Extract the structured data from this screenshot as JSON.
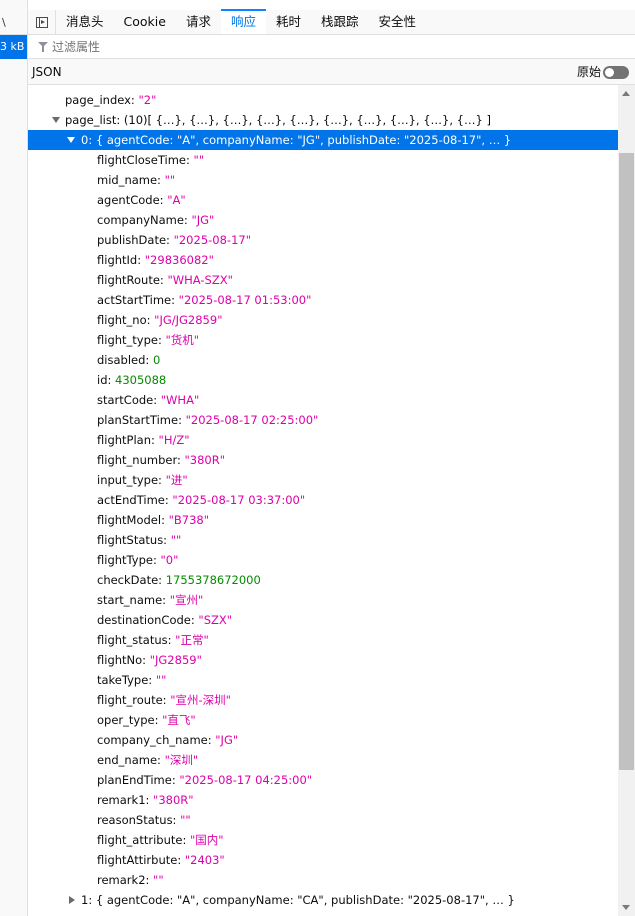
{
  "left": {
    "top_glyph": "\\",
    "size_label": "3 kB"
  },
  "tabs": [
    {
      "label": "消息头",
      "active": false
    },
    {
      "label": "Cookie",
      "active": false
    },
    {
      "label": "请求",
      "active": false
    },
    {
      "label": "响应",
      "active": true
    },
    {
      "label": "耗时",
      "active": false
    },
    {
      "label": "栈跟踪",
      "active": false
    },
    {
      "label": "安全性",
      "active": false
    }
  ],
  "filter": {
    "placeholder": "过滤属性"
  },
  "jsonbar": {
    "label": "JSON",
    "raw_label": "原始"
  },
  "tree": {
    "page_index": {
      "key": "page_index:",
      "value": "\"2\""
    },
    "page_list": {
      "key": "page_list:",
      "summary": "(10)[ {…}, {…}, {…}, {…}, {…}, {…}, {…}, {…}, {…}, {…} ]"
    },
    "item0": {
      "key": "0:",
      "summary": "{ agentCode: \"A\", companyName: \"JG\", publishDate: \"2025-08-17\", … }"
    },
    "fields": [
      {
        "key": "flightCloseTime:",
        "value": "\"\"",
        "type": "str"
      },
      {
        "key": "mid_name:",
        "value": "\"\"",
        "type": "str"
      },
      {
        "key": "agentCode:",
        "value": "\"A\"",
        "type": "str"
      },
      {
        "key": "companyName:",
        "value": "\"JG\"",
        "type": "str"
      },
      {
        "key": "publishDate:",
        "value": "\"2025-08-17\"",
        "type": "str"
      },
      {
        "key": "flightId:",
        "value": "\"29836082\"",
        "type": "str"
      },
      {
        "key": "flightRoute:",
        "value": "\"WHA-SZX\"",
        "type": "str"
      },
      {
        "key": "actStartTime:",
        "value": "\"2025-08-17 01:53:00\"",
        "type": "str"
      },
      {
        "key": "flight_no:",
        "value": "\"JG/JG2859\"",
        "type": "str"
      },
      {
        "key": "flight_type:",
        "value": "\"货机\"",
        "type": "str"
      },
      {
        "key": "disabled:",
        "value": "0",
        "type": "num"
      },
      {
        "key": "id:",
        "value": "4305088",
        "type": "num"
      },
      {
        "key": "startCode:",
        "value": "\"WHA\"",
        "type": "str"
      },
      {
        "key": "planStartTime:",
        "value": "\"2025-08-17 02:25:00\"",
        "type": "str"
      },
      {
        "key": "flightPlan:",
        "value": "\"H/Z\"",
        "type": "str"
      },
      {
        "key": "flight_number:",
        "value": "\"380R\"",
        "type": "str"
      },
      {
        "key": "input_type:",
        "value": "\"进\"",
        "type": "str"
      },
      {
        "key": "actEndTime:",
        "value": "\"2025-08-17 03:37:00\"",
        "type": "str"
      },
      {
        "key": "flightModel:",
        "value": "\"B738\"",
        "type": "str"
      },
      {
        "key": "flightStatus:",
        "value": "\"\"",
        "type": "str"
      },
      {
        "key": "flightType:",
        "value": "\"0\"",
        "type": "str"
      },
      {
        "key": "checkDate:",
        "value": "1755378672000",
        "type": "num"
      },
      {
        "key": "start_name:",
        "value": "\"宣州\"",
        "type": "str"
      },
      {
        "key": "destinationCode:",
        "value": "\"SZX\"",
        "type": "str"
      },
      {
        "key": "flight_status:",
        "value": "\"正常\"",
        "type": "str"
      },
      {
        "key": "flightNo:",
        "value": "\"JG2859\"",
        "type": "str"
      },
      {
        "key": "takeType:",
        "value": "\"\"",
        "type": "str"
      },
      {
        "key": "flight_route:",
        "value": "\"宣州-深圳\"",
        "type": "str"
      },
      {
        "key": "oper_type:",
        "value": "\"直飞\"",
        "type": "str"
      },
      {
        "key": "company_ch_name:",
        "value": "\"JG\"",
        "type": "str"
      },
      {
        "key": "end_name:",
        "value": "\"深圳\"",
        "type": "str"
      },
      {
        "key": "planEndTime:",
        "value": "\"2025-08-17 04:25:00\"",
        "type": "str"
      },
      {
        "key": "remark1:",
        "value": "\"380R\"",
        "type": "str"
      },
      {
        "key": "reasonStatus:",
        "value": "\"\"",
        "type": "str"
      },
      {
        "key": "flight_attribute:",
        "value": "\"国内\"",
        "type": "str"
      },
      {
        "key": "flightAttirbute:",
        "value": "\"2403\"",
        "type": "str"
      },
      {
        "key": "remark2:",
        "value": "\"\"",
        "type": "str"
      }
    ],
    "item1": {
      "key": "1:",
      "summary": "{ agentCode: \"A\", companyName: \"CA\", publishDate: \"2025-08-17\", … }"
    }
  },
  "colors": {
    "accent": "#0074e8",
    "string": "#dd00a9",
    "number": "#058b00"
  }
}
